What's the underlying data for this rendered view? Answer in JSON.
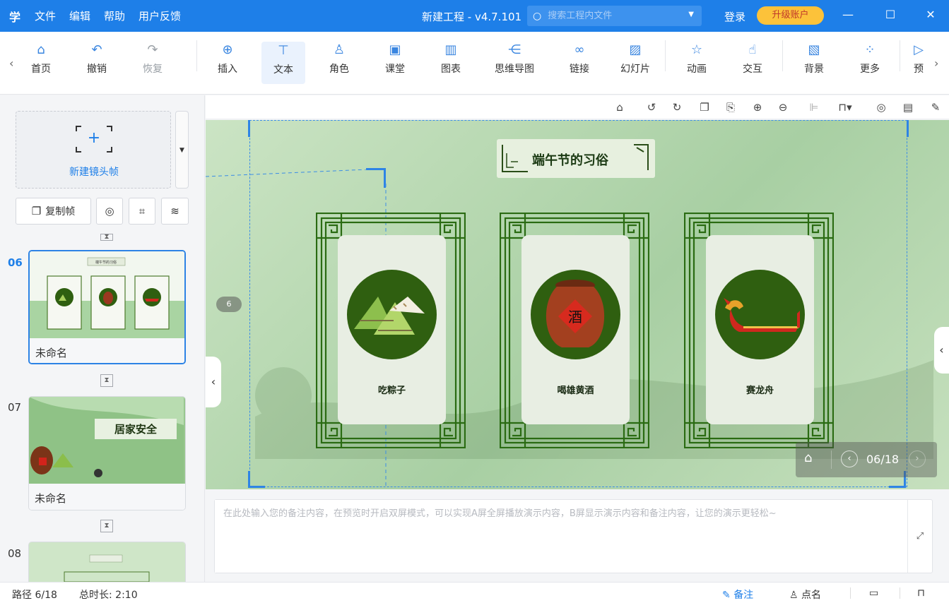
{
  "titlebar": {
    "logo": "学",
    "menu": [
      "文件",
      "编辑",
      "帮助",
      "用户反馈"
    ],
    "title": "新建工程 - v4.7.101",
    "search_placeholder": "搜索工程内文件",
    "login": "登录",
    "upgrade": "升级账户"
  },
  "toolbar": {
    "items": [
      {
        "label": "首页",
        "icon": "home-icon",
        "glyph": "⌂"
      },
      {
        "label": "撤销",
        "icon": "undo-icon",
        "glyph": "↶"
      },
      {
        "label": "恢复",
        "icon": "redo-icon",
        "glyph": "↷"
      },
      {
        "label": "插入",
        "icon": "plus-circle-icon",
        "glyph": "⊕"
      },
      {
        "label": "文本",
        "icon": "text-icon",
        "glyph": "T"
      },
      {
        "label": "角色",
        "icon": "person-icon",
        "glyph": "♙"
      },
      {
        "label": "课堂",
        "icon": "classroom-icon",
        "glyph": "▣"
      },
      {
        "label": "图表",
        "icon": "chart-icon",
        "glyph": "▥"
      },
      {
        "label": "思维导图",
        "icon": "mindmap-icon",
        "glyph": "⋲"
      },
      {
        "label": "链接",
        "icon": "link-icon",
        "glyph": "∞"
      },
      {
        "label": "幻灯片",
        "icon": "slideshow-icon",
        "glyph": "▨"
      },
      {
        "label": "动画",
        "icon": "star-icon",
        "glyph": "☆"
      },
      {
        "label": "交互",
        "icon": "hand-icon",
        "glyph": "☝"
      },
      {
        "label": "背景",
        "icon": "background-icon",
        "glyph": "▧"
      },
      {
        "label": "更多",
        "icon": "more-icon",
        "glyph": "⁘"
      },
      {
        "label": "预",
        "icon": "preview-icon",
        "glyph": "▷"
      }
    ]
  },
  "sidebar": {
    "new_frame_label": "新建镜头帧",
    "copy_frame_label": "复制帧",
    "slides": [
      {
        "number": "06",
        "name": "未命名",
        "thumb_title": "端午节的习俗"
      },
      {
        "number": "07",
        "name": "未命名",
        "thumb_title": "居家安全"
      },
      {
        "number": "08",
        "name": "",
        "thumb_title": ""
      }
    ]
  },
  "canvas": {
    "badge": "6",
    "slide_title": "端午节的习俗",
    "customs": [
      {
        "label": "吃粽子",
        "art": "zongzi"
      },
      {
        "label": "喝雄黄酒",
        "art": "wine-jar"
      },
      {
        "label": "赛龙舟",
        "art": "dragon-boat"
      }
    ],
    "jar_char": "酒",
    "page_indicator": "06/18"
  },
  "notes": {
    "placeholder": "在此处输入您的备注内容，在预览时开启双屏模式，可以实现A屏全屏播放演示内容，B屏显示演示内容和备注内容，让您的演示更轻松~"
  },
  "status": {
    "path": "路径 6/18",
    "duration": "总时长: 2:10",
    "notes_btn": "备注",
    "rollcall_btn": "点名"
  },
  "colors": {
    "primary": "#1e7fe8",
    "upgrade_bg": "#fcc23a",
    "slide_green": "#2f5f10",
    "frame_line": "#2a6b12"
  }
}
